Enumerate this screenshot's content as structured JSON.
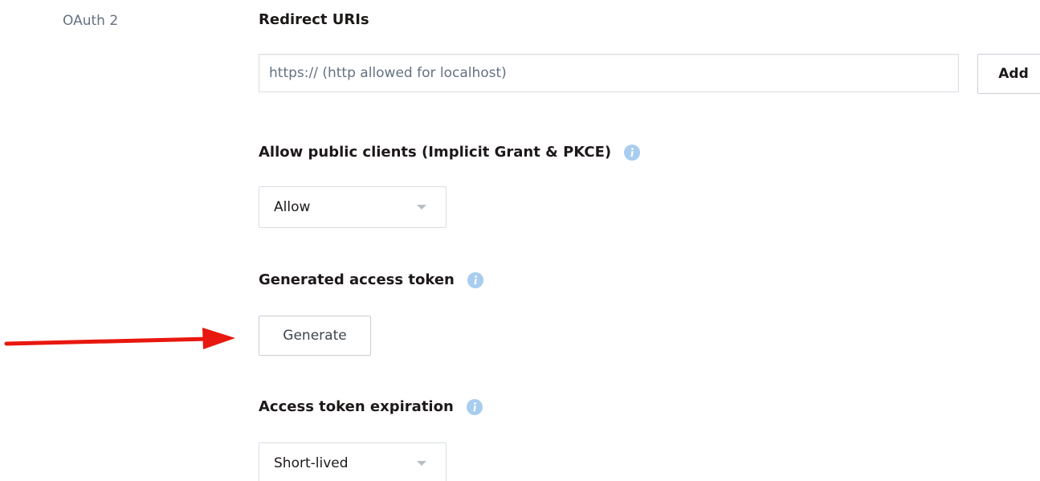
{
  "section": {
    "label": "OAuth 2"
  },
  "redirect_uris": {
    "title": "Redirect URIs",
    "input_placeholder": "https:// (http allowed for localhost)",
    "input_value": "",
    "add_label": "Add"
  },
  "public_clients": {
    "title": "Allow public clients (Implicit Grant & PKCE)",
    "info_icon": "info-icon",
    "selected": "Allow"
  },
  "access_token": {
    "title": "Generated access token",
    "info_icon": "info-icon",
    "generate_label": "Generate"
  },
  "token_expiration": {
    "title": "Access token expiration",
    "info_icon": "info-icon",
    "selected": "Short-lived"
  },
  "colors": {
    "annotation_arrow": "#e8170f",
    "info_icon": "#a8cdef",
    "muted_text": "#637282"
  }
}
